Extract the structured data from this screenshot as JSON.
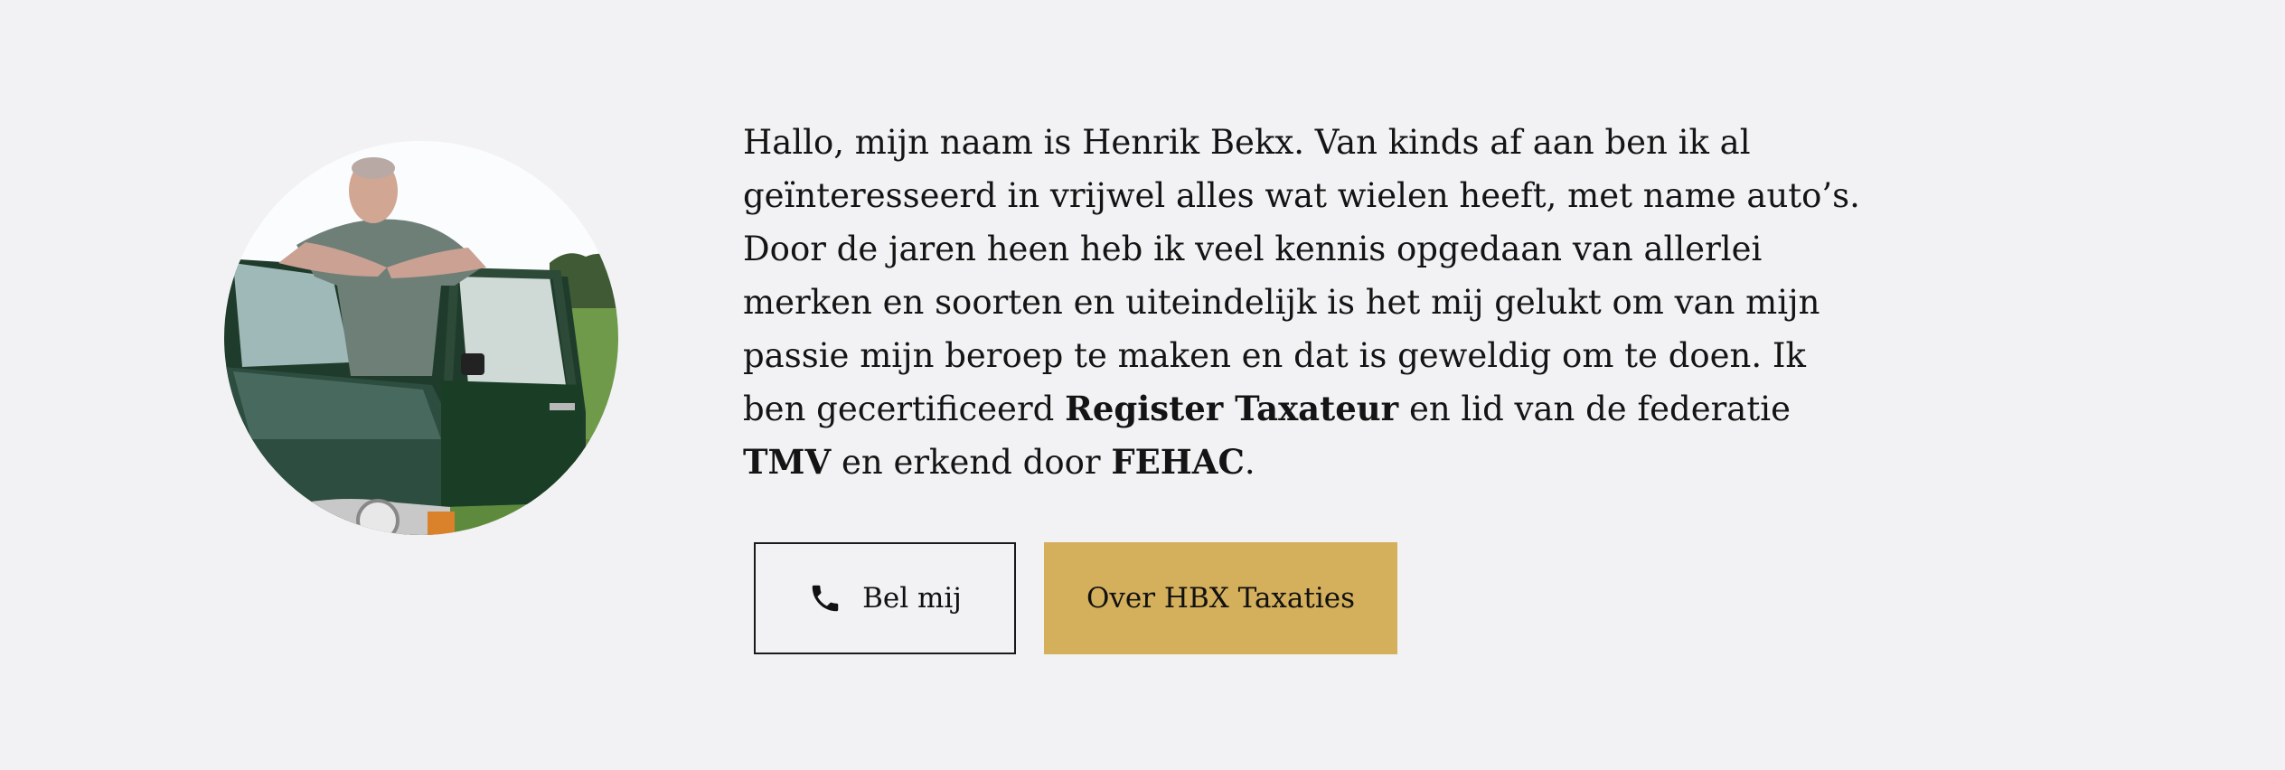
{
  "intro": {
    "portrait_alt": "Henrik Bekx bij een groene klassieke auto",
    "bio_part1": "Hallo, mijn naam is Henrik Bekx. Van kinds af aan ben ik al geïnteresseerd in vrijwel alles wat wielen heeft, met name auto’s. Door de jaren heen heb ik veel kennis opgedaan van allerlei merken en soorten en uiteindelijk is het mij gelukt om van mijn passie mijn beroep te maken en dat is geweldig om te doen. Ik ben gecertificeerd ",
    "bio_bold1": "Register Taxateur",
    "bio_part2": " en lid van de federatie ",
    "bio_bold2": "TMV",
    "bio_part3": " en erkend door ",
    "bio_bold3": "FEHAC",
    "bio_part4": "."
  },
  "buttons": {
    "call_label": "Bel mij",
    "about_label": "Over HBX Taxaties"
  },
  "colors": {
    "background": "#f2f2f4",
    "accent": "#d4af5c",
    "text": "#141414"
  },
  "icons": {
    "call": "phone-icon"
  }
}
